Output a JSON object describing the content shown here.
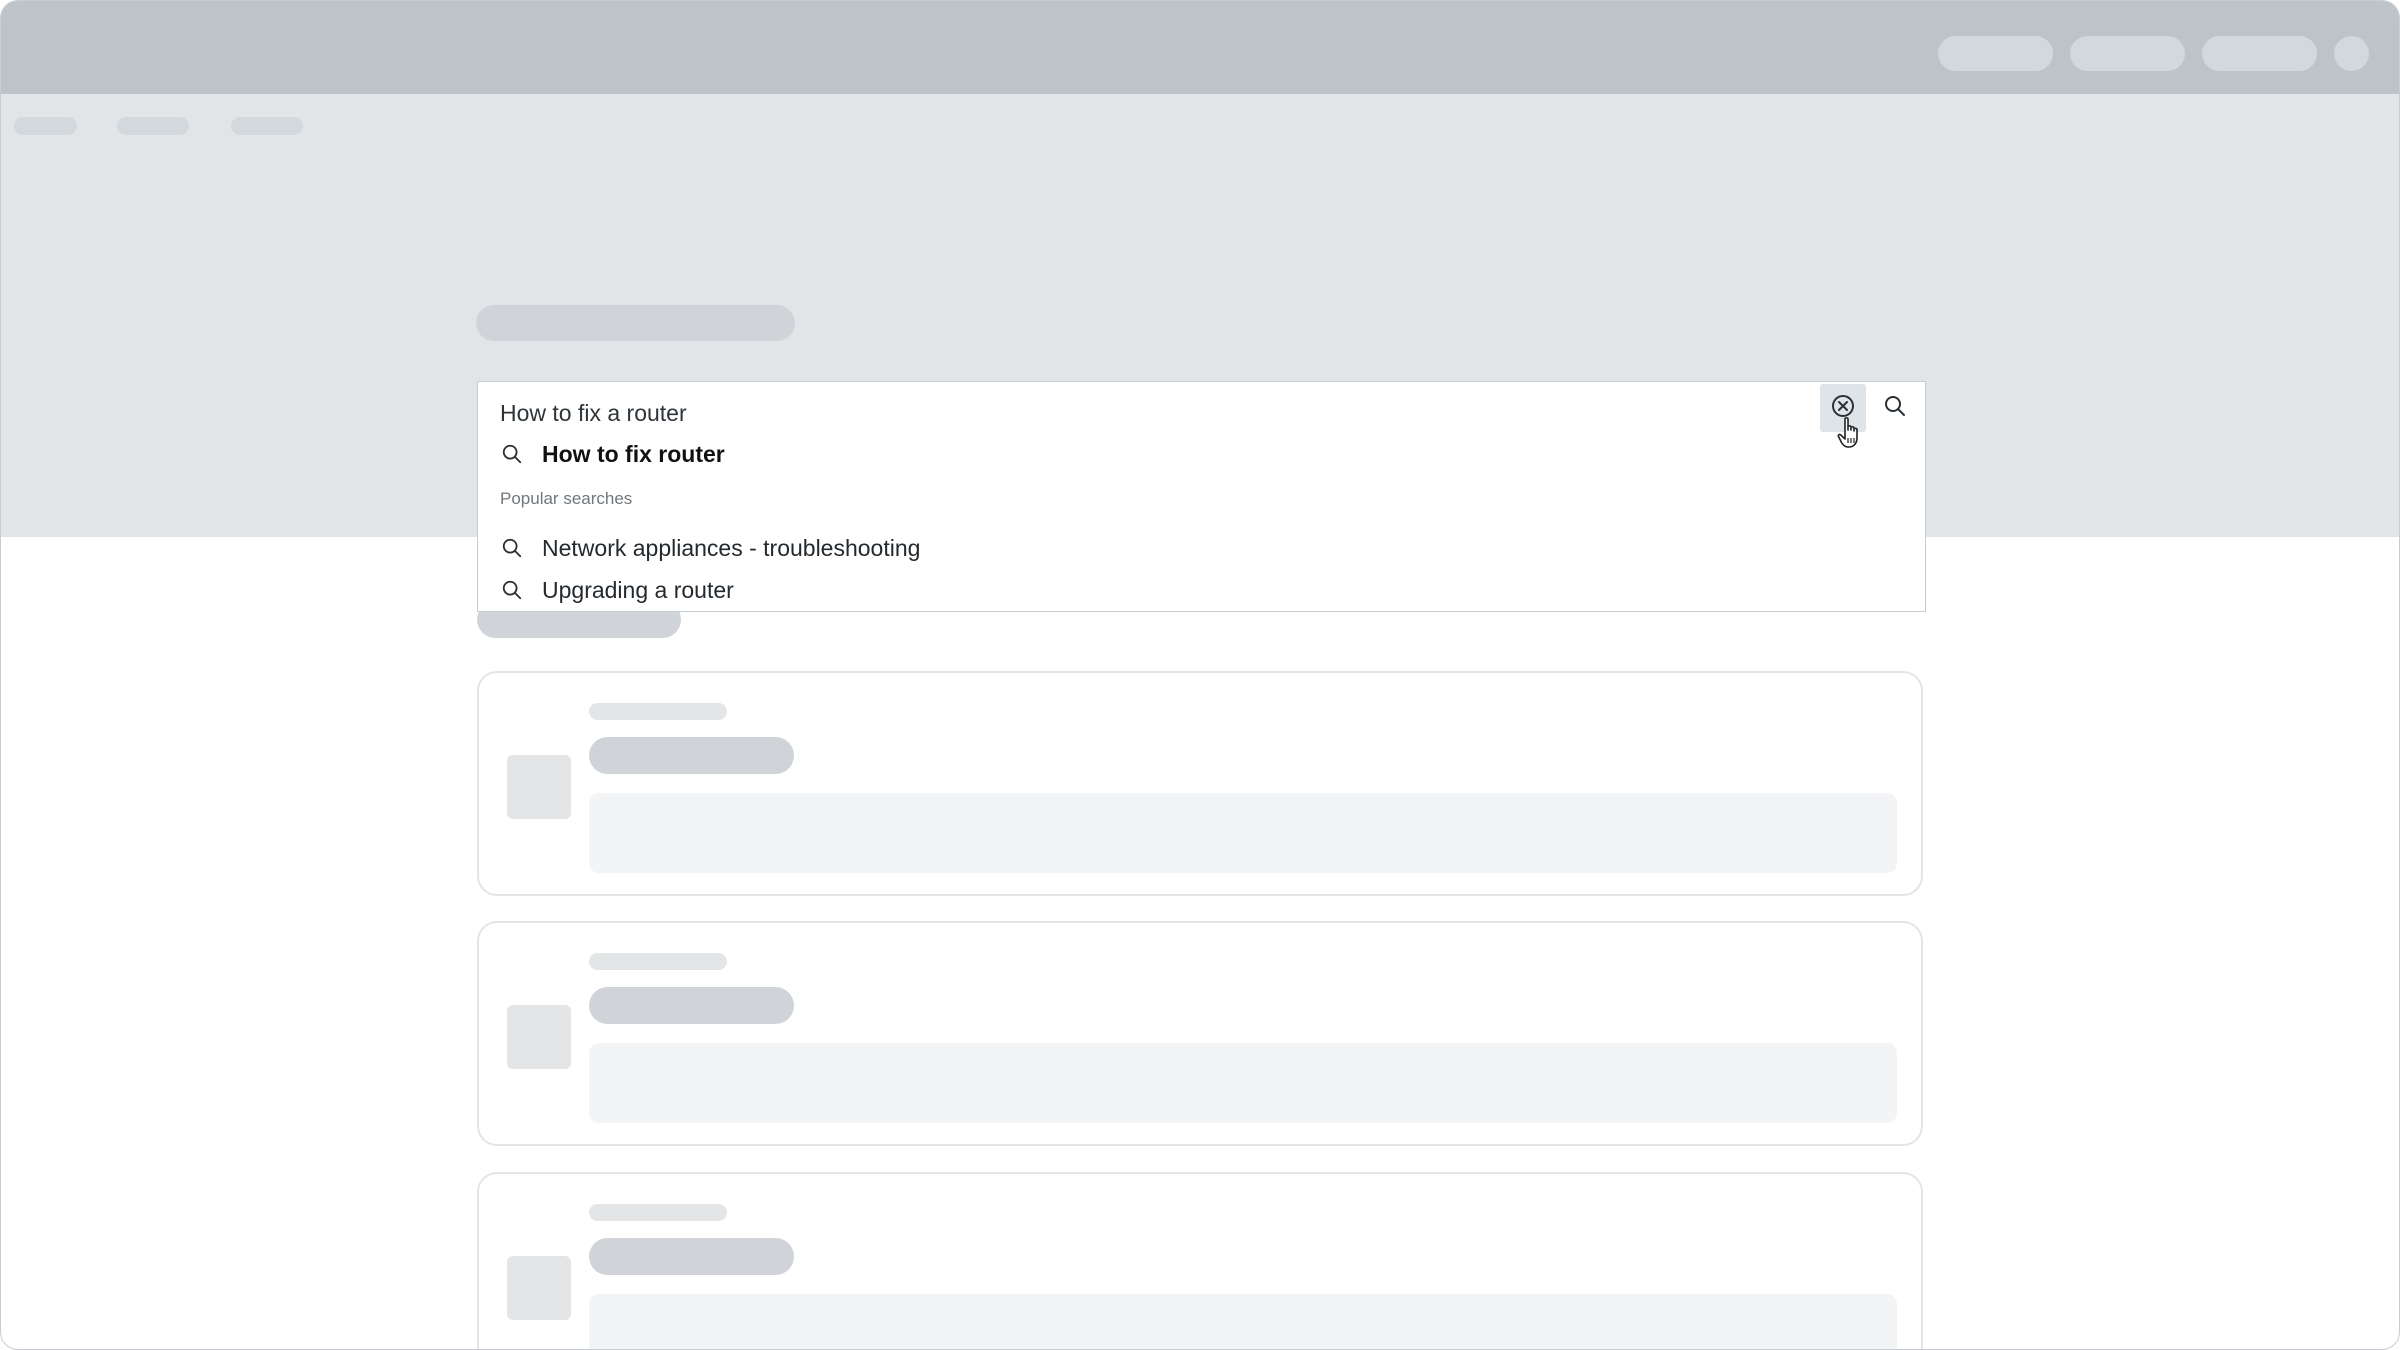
{
  "search": {
    "value": "How to fix a router",
    "suggestions": [
      {
        "label": "How to fix router",
        "bold": true
      }
    ],
    "popular_label": "Popular searches",
    "popular": [
      {
        "label": "Network appliances - troubleshooting"
      },
      {
        "label": "Upgrading a router"
      }
    ]
  },
  "icons": {
    "clear": "close-circle-icon",
    "search": "search-icon",
    "cursor": "hand-pointer-icon"
  },
  "colors": {
    "topbar": "#bdc3c7",
    "hero": "#e2e5e8",
    "clear_hover": "#dfe4e8"
  }
}
